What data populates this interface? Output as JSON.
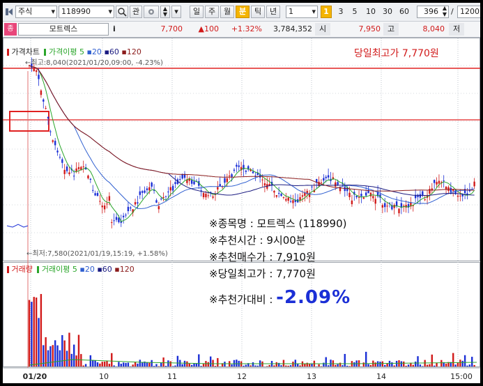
{
  "toolbar": {
    "market_type": "주식",
    "code": "118990",
    "btn_gwan": "관",
    "periods": [
      "일",
      "주",
      "월",
      "분",
      "틱",
      "년"
    ],
    "active_period": "분",
    "interval_value": "1",
    "interval_badge": "1",
    "quick_intervals": [
      "3",
      "5",
      "10",
      "30",
      "60"
    ],
    "count_value": "396",
    "total_value": "1200"
  },
  "quote": {
    "badge": "종",
    "name": "모트렉스",
    "info_icon": "i",
    "price": "7,700",
    "change": "▲100",
    "change_pct": "+1.32%",
    "volume": "3,784,352",
    "open_label": "시",
    "open": "7,950",
    "high_label": "고",
    "high": "8,040",
    "low_label": "저"
  },
  "price_pane": {
    "legend_main": "가격차트",
    "legend_ma_label": "가격이평",
    "legend_ma": [
      "5",
      "20",
      "60",
      "120"
    ],
    "legend_ma_colors": [
      "#2aa52a",
      "#2f5fd0",
      "#1a1a80",
      "#8b1c1c"
    ],
    "high_marker": "←최고:8,040(2021/01/20,09:00, -4.23%)",
    "low_marker": "←최저:7,580(2021/01/19,15:19, +1.58%)",
    "day_high_banner": "당일최고가 7,770원"
  },
  "volume_pane": {
    "legend_main": "거래량",
    "legend_ma_label": "거래이평",
    "legend_ma": [
      "5",
      "20",
      "60",
      "120"
    ]
  },
  "x_axis": [
    "01/20",
    "10",
    "11",
    "12",
    "13",
    "14",
    "15:00"
  ],
  "overlay": {
    "line1": "※종목명 : 모트렉스 (118990)",
    "line2": "※추천시간 : 9시00분",
    "line3": "※추천매수가 : 7,910원",
    "line4": "※당일최고가 : 7,770원",
    "line5_label": "※추천가대비 :",
    "line5_value": "-2.09%"
  },
  "colors": {
    "up": "#d11a1a",
    "down": "#1b2fd6",
    "accent": "#f4b400"
  }
}
